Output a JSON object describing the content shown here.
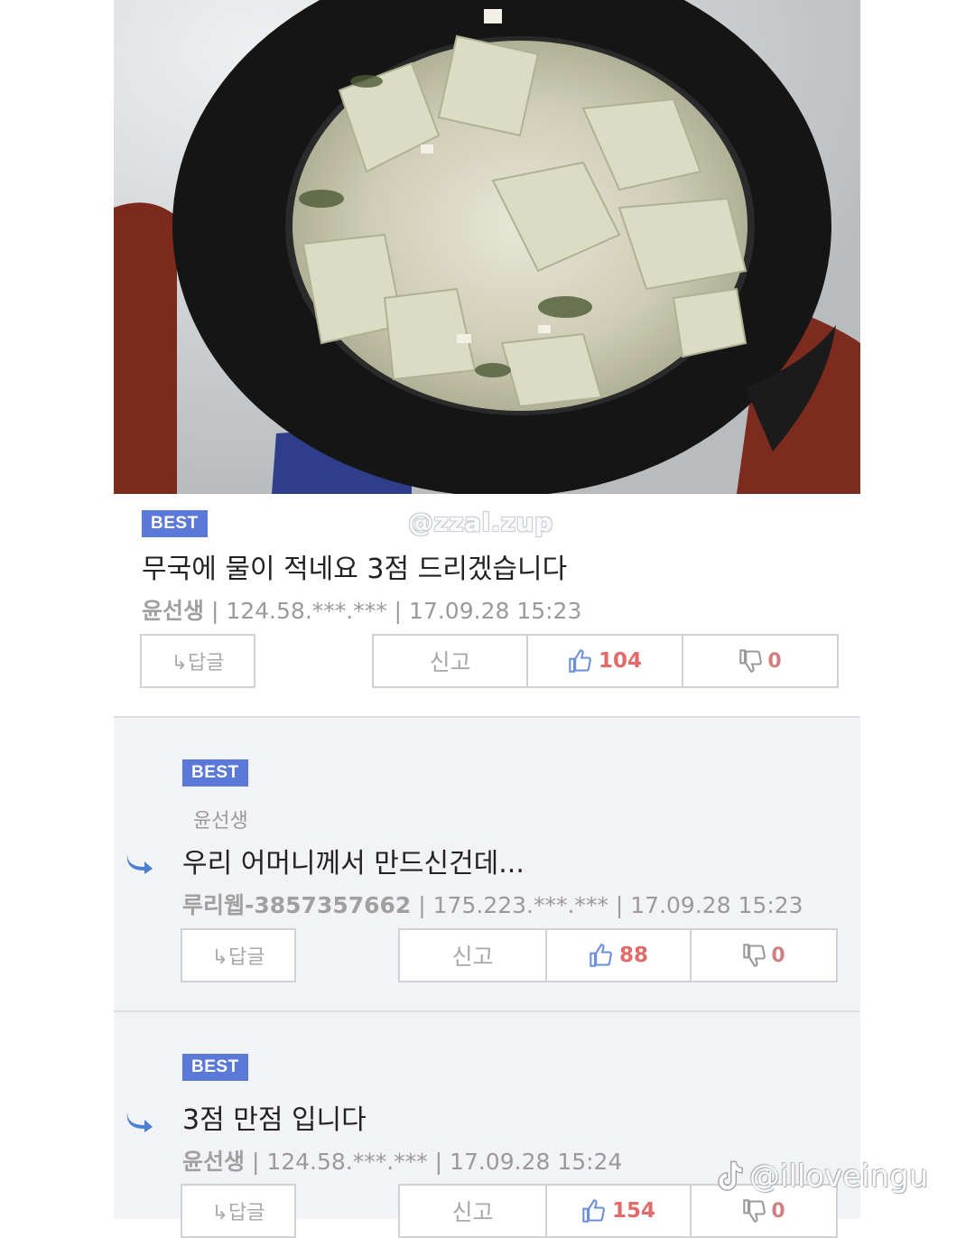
{
  "photo": {
    "alt": "radish soup in black pot"
  },
  "watermarks": {
    "top": "@zzal.zup",
    "bottom": "@illoveingu"
  },
  "comments": [
    {
      "badge": "BEST",
      "text": "무국에 물이 적네요 3점 드리겠습니다",
      "nick": "윤선생",
      "ip": "124.58.***.***",
      "time": "17.09.28 15:23",
      "reply_label": "↳답글",
      "report_label": "신고",
      "likes": "104",
      "dislikes": "0"
    },
    {
      "badge": "BEST",
      "mention": "윤선생",
      "text": "우리 어머니께서 만드신건데...",
      "nick": "루리웹-3857357662",
      "ip": "175.223.***.***",
      "time": "17.09.28 15:23",
      "reply_label": "↳답글",
      "report_label": "신고",
      "likes": "88",
      "dislikes": "0"
    },
    {
      "badge": "BEST",
      "text": "3점 만점 입니다",
      "nick": "윤선생",
      "ip": "124.58.***.***",
      "time": "17.09.28 15:24",
      "reply_label": "↳답글",
      "report_label": "신고",
      "likes": "154",
      "dislikes": "0"
    }
  ],
  "colors": {
    "best_badge": "#5b79d8",
    "like": "#e26a6a",
    "reply_arrow": "#4a7fd4"
  }
}
